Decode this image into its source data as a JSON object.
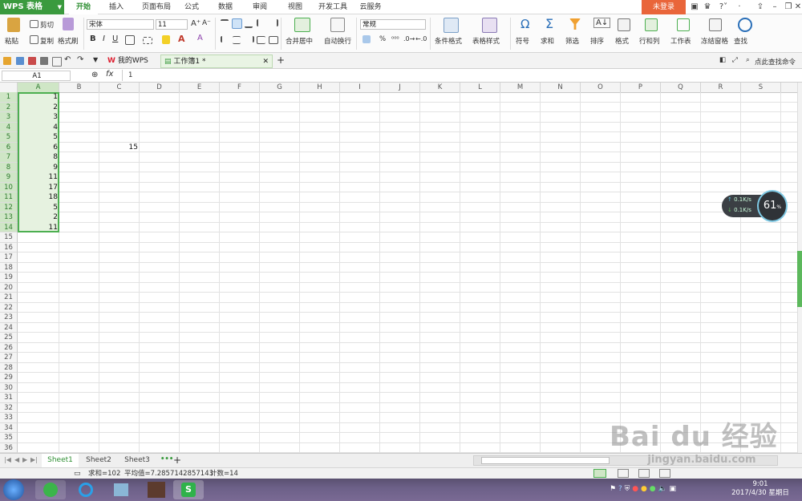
{
  "app": {
    "logo": "WPS 表格",
    "login": "未登录"
  },
  "menu": {
    "tabs": [
      "开始",
      "插入",
      "页面布局",
      "公式",
      "数据",
      "审阅",
      "视图",
      "开发工具",
      "云服务"
    ],
    "active": "开始"
  },
  "ribbon": {
    "paste": "粘贴",
    "cut": "剪切",
    "copy": "复制",
    "format_painter": "格式刷",
    "font_name": "宋体",
    "font_size": "11",
    "bold": "B",
    "italic": "I",
    "underline": "U",
    "merge_center": "合并居中",
    "auto_wrap": "自动换行",
    "number_format": "常规",
    "percent": "%",
    "conditional_format": "条件格式",
    "table_style": "表格样式",
    "symbol": "符号",
    "sum": "求和",
    "filter": "筛选",
    "sort": "排序",
    "format": "格式",
    "row_col": "行和列",
    "worksheet": "工作表",
    "freeze": "冻结窗格",
    "find": "查找"
  },
  "quickbar": {
    "my_wps": "我的WPS",
    "workbook": "工作簿1 *",
    "search_cmd": "点此查找命令"
  },
  "formula": {
    "name_box": "A1",
    "fx": "fx",
    "value": "1"
  },
  "grid": {
    "columns": [
      "A",
      "B",
      "C",
      "D",
      "E",
      "F",
      "G",
      "H",
      "I",
      "J",
      "K",
      "L",
      "M",
      "N",
      "O",
      "P",
      "Q",
      "R",
      "S"
    ],
    "row_count": 36,
    "col_a_values": [
      "1",
      "2",
      "3",
      "4",
      "5",
      "6",
      "8",
      "9",
      "11",
      "17",
      "18",
      "5",
      "2",
      "11"
    ],
    "extra_cell": {
      "row": 6,
      "col": "C",
      "value": "15"
    }
  },
  "sheets": {
    "tabs": [
      "Sheet1",
      "Sheet2",
      "Sheet3"
    ],
    "active": "Sheet1"
  },
  "status": {
    "sum": "求和=102",
    "avg": "平均值=7.2857142857143",
    "count": "计数=14"
  },
  "speed": {
    "up": "0.1K/s",
    "down": "0.1K/s",
    "percent": "61",
    "unit": "%"
  },
  "clock": {
    "time": "9:01",
    "date": "2017/4/30 星期日"
  },
  "watermark": {
    "brand": "Bai du 经验",
    "url": "jingyan.baidu.com"
  },
  "colors": {
    "accent": "#3a9a3e",
    "login": "#e9653a",
    "selection": "#4caf50"
  }
}
